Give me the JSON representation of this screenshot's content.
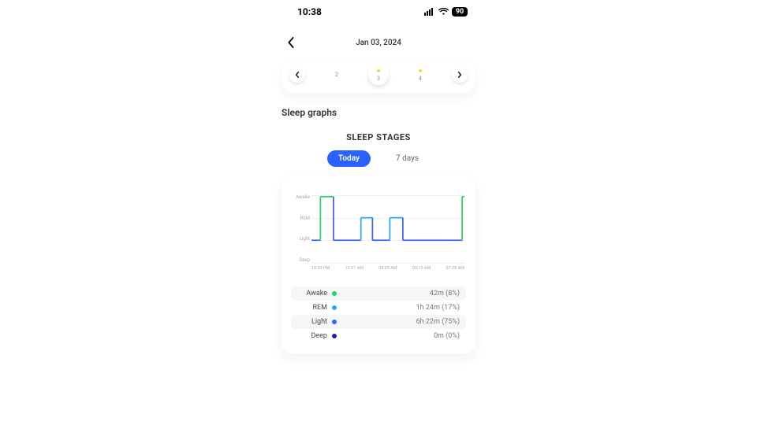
{
  "status": {
    "time": "10:38",
    "battery": "90"
  },
  "header": {
    "date": "Jan 03, 2024"
  },
  "day_strip": {
    "items": [
      {
        "num": "2",
        "star": false
      },
      {
        "num": "3",
        "star": true
      },
      {
        "num": "4",
        "star": true
      }
    ]
  },
  "section_title": "Sleep graphs",
  "graph_title": "SLEEP STAGES",
  "tabs": {
    "today": "Today",
    "week": "7 days"
  },
  "stages": {
    "y_labels": [
      "Awake",
      "REM",
      "Light",
      "Deep"
    ],
    "x_labels": [
      "10:39 PM",
      "12:51 AM",
      "03:03 AM",
      "05:15 AM",
      "07:28 AM"
    ]
  },
  "legend": [
    {
      "label": "Awake",
      "color": "#2bd45b",
      "value": "42m (8%)",
      "shade": true
    },
    {
      "label": "REM",
      "color": "#2aa9ff",
      "value": "1h 24m (17%)",
      "shade": false
    },
    {
      "label": "Light",
      "color": "#3a62ff",
      "value": "6h 22m (75%)",
      "shade": true
    },
    {
      "label": "Deep",
      "color": "#1a1dbb",
      "value": "0m (0%)",
      "shade": false
    }
  ],
  "chart_data": {
    "type": "line",
    "title": "SLEEP STAGES",
    "xlabel": "",
    "ylabel": "",
    "y_categories": [
      "Awake",
      "REM",
      "Light",
      "Deep"
    ],
    "x_range": [
      "10:39 PM",
      "07:28 AM"
    ],
    "x_ticks": [
      "10:39 PM",
      "12:51 AM",
      "03:03 AM",
      "05:15 AM",
      "07:28 AM"
    ],
    "segments": [
      {
        "stage": "Light",
        "start": "10:39 PM",
        "end": "11:10 PM"
      },
      {
        "stage": "Awake",
        "start": "11:10 PM",
        "end": "11:55 PM"
      },
      {
        "stage": "Light",
        "start": "11:55 PM",
        "end": "01:30 AM"
      },
      {
        "stage": "REM",
        "start": "01:30 AM",
        "end": "02:10 AM"
      },
      {
        "stage": "Light",
        "start": "02:10 AM",
        "end": "03:10 AM"
      },
      {
        "stage": "REM",
        "start": "03:10 AM",
        "end": "03:55 AM"
      },
      {
        "stage": "Light",
        "start": "03:55 AM",
        "end": "07:20 AM"
      },
      {
        "stage": "Awake",
        "start": "07:20 AM",
        "end": "07:28 AM"
      }
    ],
    "summary": {
      "Awake": {
        "duration_min": 42,
        "pct": 8
      },
      "REM": {
        "duration_min": 84,
        "pct": 17
      },
      "Light": {
        "duration_min": 382,
        "pct": 75
      },
      "Deep": {
        "duration_min": 0,
        "pct": 0
      }
    }
  }
}
